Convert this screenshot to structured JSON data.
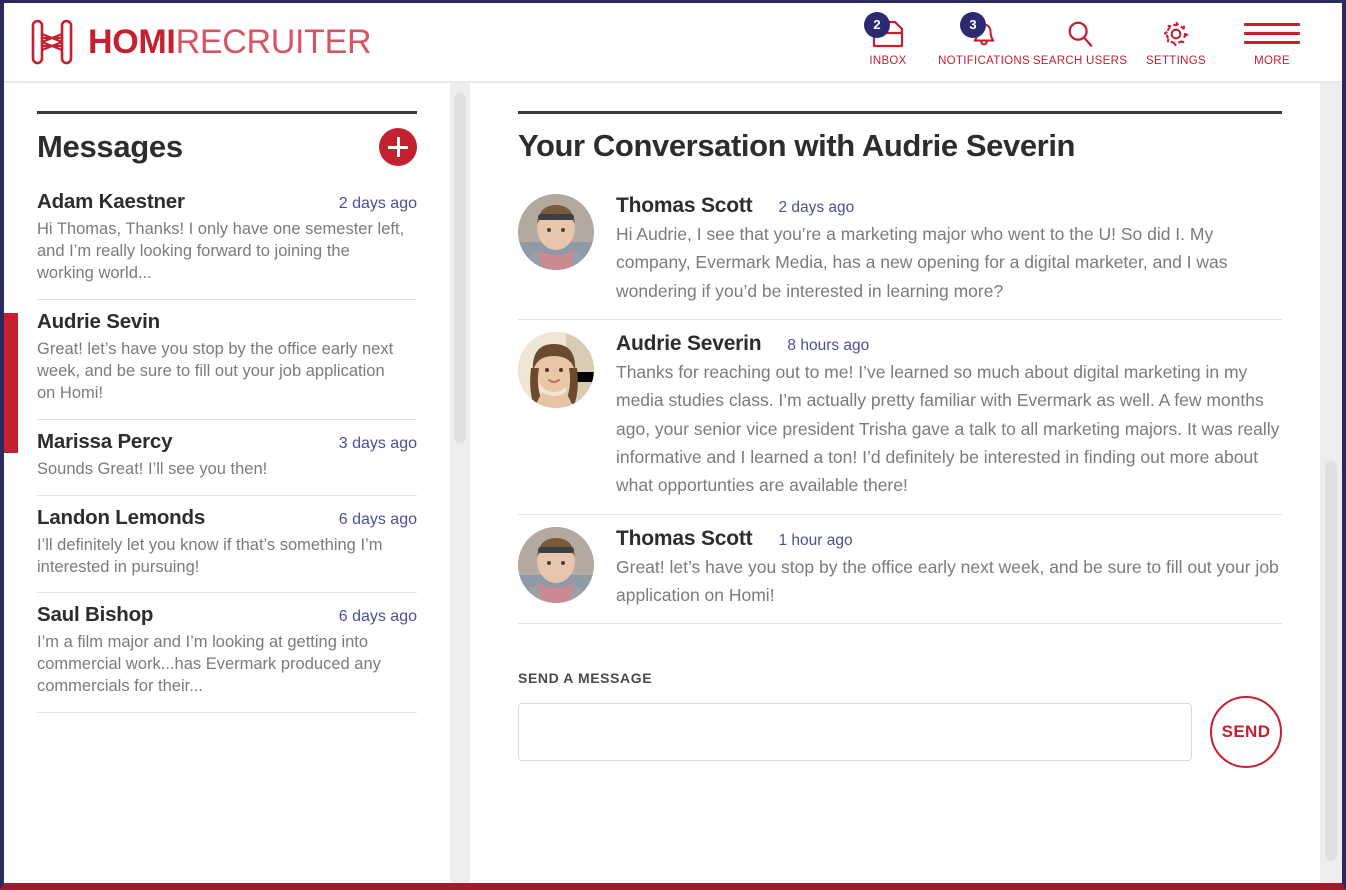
{
  "brand": {
    "name_bold": "HOMI",
    "name_light": "RECRUITER",
    "logo_icon": "homi-h-logo-icon"
  },
  "colors": {
    "brand_red": "#c4202f",
    "brand_red_light": "#d45563",
    "badge_navy": "#2b2a6e",
    "timestamp_blue": "#4d4f96",
    "body_gray": "#7b7b7f",
    "frame_navy": "#2b2a5e",
    "frame_bottom_red": "#9e1b2f"
  },
  "header": {
    "nav": [
      {
        "label": "INBOX",
        "icon": "inbox-tray-icon",
        "badge": "2"
      },
      {
        "label": "NOTIFICATIONS",
        "icon": "bell-icon",
        "badge": "3"
      },
      {
        "label": "SEARCH USERS",
        "icon": "search-icon",
        "badge": ""
      },
      {
        "label": "SETTINGS",
        "icon": "gear-icon",
        "badge": ""
      },
      {
        "label": "MORE",
        "icon": "hamburger-menu-icon",
        "badge": ""
      }
    ]
  },
  "sidebar": {
    "title": "Messages",
    "new_message_icon": "plus-circle-icon",
    "items": [
      {
        "name": "Adam Kaestner",
        "time": "2 days ago",
        "snippet": "Hi Thomas, Thanks! I only have one semester left, and I’m really looking forward to joining the working world...",
        "active": false
      },
      {
        "name": "Audrie Sevin",
        "time": "",
        "snippet": "Great! let’s have you stop by the  office early next week, and be sure to fill out your job application on Homi!",
        "active": true
      },
      {
        "name": "Marissa Percy",
        "time": "3 days ago",
        "snippet": "Sounds Great! I’ll see you then!",
        "active": false
      },
      {
        "name": "Landon Lemonds",
        "time": "6 days ago",
        "snippet": "I’ll definitely let you know if that’s something I’m interested in pursuing!",
        "active": false
      },
      {
        "name": "Saul Bishop",
        "time": "6 days ago",
        "snippet": "I’m a film major and I’m looking at getting into commercial work...has Evermark produced any commercials for their...",
        "active": false
      }
    ]
  },
  "conversation": {
    "title": "Your Conversation with Audrie Severin",
    "messages": [
      {
        "author": "Thomas Scott",
        "time": "2 days ago",
        "avatar": "avatar-thomas-scott",
        "text": "Hi Audrie, I see that you’re a marketing major who went to the U! So did I. My company,  Evermark Media, has a new opening for a digital marketer, and I was wondering if you’d be interested in learning more?"
      },
      {
        "author": "Audrie Severin",
        "time": "8 hours ago",
        "avatar": "avatar-audrie-severin",
        "text": "Thanks for reaching out to me! I’ve learned so much about digital marketing in my media studies class. I’m actually pretty familiar with Evermark as well. A few months ago, your senior vice president Trisha gave a talk to all marketing majors. It was really informative and I learned a ton! I’d definitely be interested in finding out more about what opportunties are available there!"
      },
      {
        "author": "Thomas Scott",
        "time": "1 hour ago",
        "avatar": "avatar-thomas-scott",
        "text": "Great! let’s have you stop by the  office early next week, and be sure to fill out your job application on Homi!"
      }
    ]
  },
  "composer": {
    "label": "SEND A MESSAGE",
    "value": "",
    "placeholder": "",
    "send_label": "SEND"
  }
}
